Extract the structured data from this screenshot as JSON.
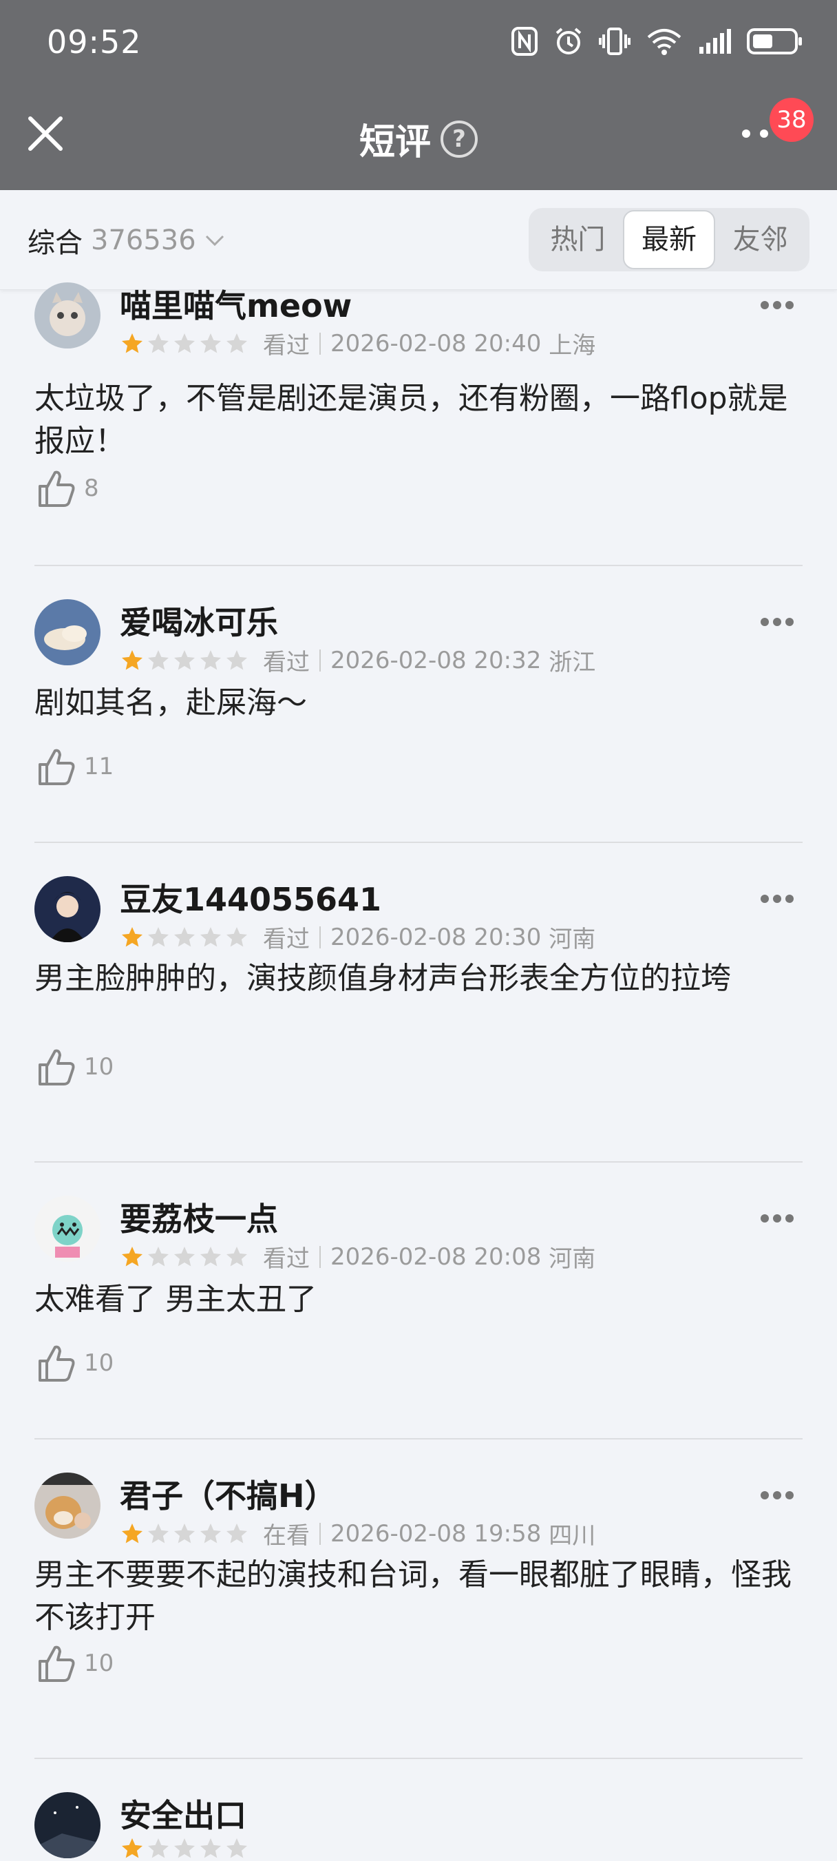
{
  "status": {
    "time": "09:52",
    "battery": ""
  },
  "header": {
    "title": "短评",
    "help": "?",
    "badge": "38"
  },
  "filter": {
    "sort_label": "综合",
    "sort_count": "376536",
    "tabs": [
      "热门",
      "最新",
      "友邻"
    ],
    "active_tab": "最新"
  },
  "reviews": [
    {
      "user": "喵里喵气meow",
      "rating": 1,
      "status": "看过",
      "datetime": "2026-02-08 20:40",
      "location": "上海",
      "content": "太垃圾了，不管是剧还是演员，还有粉圈，一路flop就是报应！",
      "likes": "8"
    },
    {
      "user": "爱喝冰可乐",
      "rating": 1,
      "status": "看过",
      "datetime": "2026-02-08 20:32",
      "location": "浙江",
      "content": "剧如其名，赴屎海～",
      "likes": "11"
    },
    {
      "user": "豆友144055641",
      "rating": 1,
      "status": "看过",
      "datetime": "2026-02-08 20:30",
      "location": "河南",
      "content": "男主脸肿肿的，演技颜值身材声台形表全方位的拉垮",
      "likes": "10"
    },
    {
      "user": "要荔枝一点",
      "rating": 1,
      "status": "看过",
      "datetime": "2026-02-08 20:08",
      "location": "河南",
      "content": "太难看了 男主太丑了",
      "likes": "10"
    },
    {
      "user": "君子（不搞H）",
      "rating": 1,
      "status": "在看",
      "datetime": "2026-02-08 19:58",
      "location": "四川",
      "content": "男主不要要不起的演技和台词，看一眼都脏了眼睛，怪我不该打开",
      "likes": "10"
    },
    {
      "user": "安全出口",
      "rating": 1,
      "status": "",
      "datetime": "",
      "location": "",
      "content": "",
      "likes": ""
    }
  ],
  "colors": {
    "header_bg": "#6b6c6f",
    "star_filled": "#f5a623",
    "star_empty": "#d6d6d6",
    "badge": "#ff4a55"
  }
}
